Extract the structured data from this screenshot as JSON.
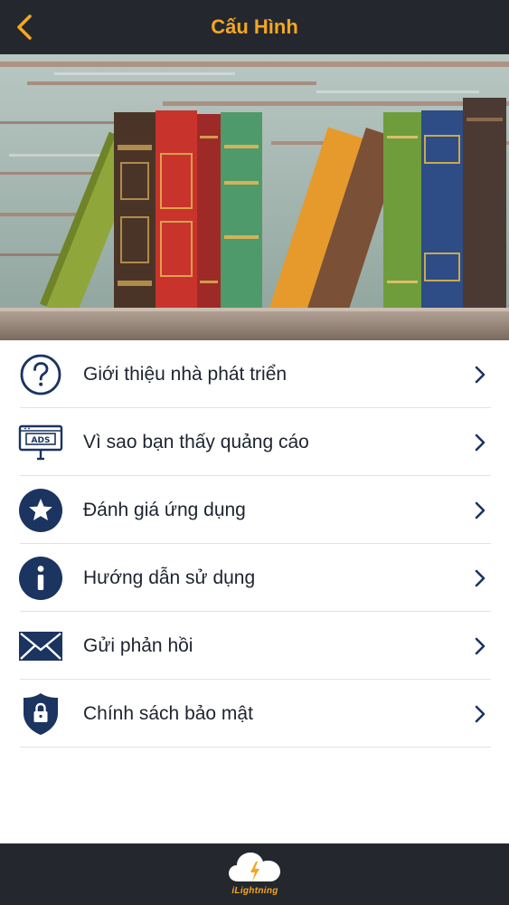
{
  "header": {
    "title": "Cấu Hình",
    "back_icon": "chevron-left-icon",
    "accent_color": "#f5a623",
    "background_color": "#24282e"
  },
  "banner": {
    "image": "books-on-shelf"
  },
  "menu": {
    "items": [
      {
        "label": "Giới thiệu nhà phát triển",
        "icon": "question-circle-icon"
      },
      {
        "label": "Vì sao bạn thấy quảng cáo",
        "icon": "ads-billboard-icon"
      },
      {
        "label": "Đánh giá ứng dụng",
        "icon": "star-circle-icon"
      },
      {
        "label": "Hướng dẫn sử dụng",
        "icon": "info-circle-icon"
      },
      {
        "label": "Gửi phản hồi",
        "icon": "envelope-icon"
      },
      {
        "label": "Chính sách bảo mật",
        "icon": "shield-lock-icon"
      }
    ],
    "icon_color": "#1b3460"
  },
  "footer": {
    "logo_text": "iLightning"
  }
}
